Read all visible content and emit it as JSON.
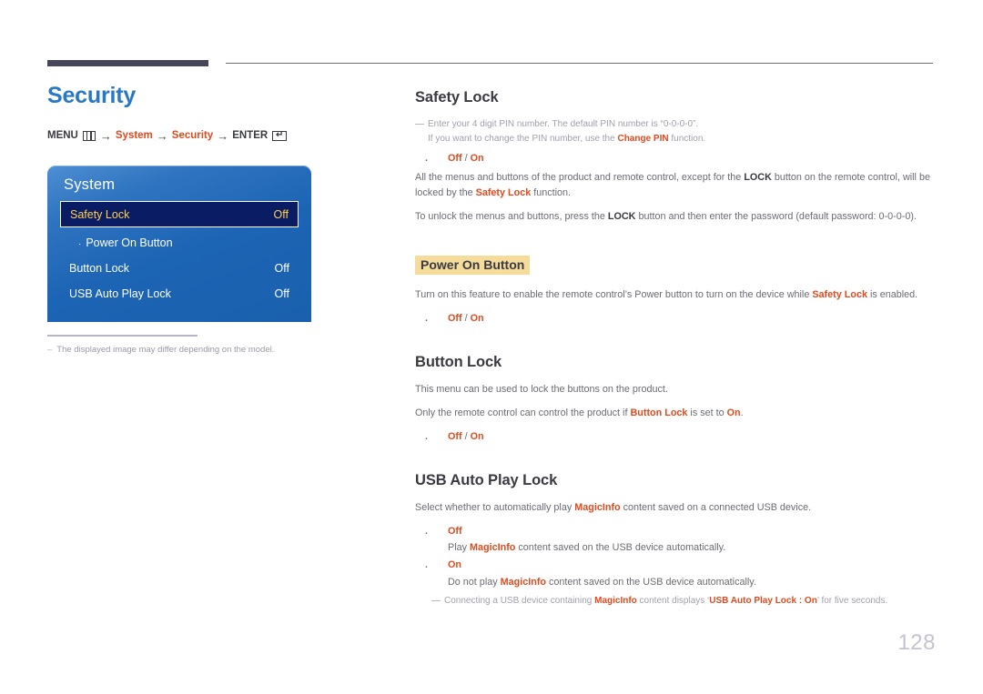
{
  "page": {
    "title": "Security",
    "number": "128"
  },
  "menu_path": {
    "menu_label": "MENU",
    "menu_icon": "menu-grid-icon",
    "arrow": "→",
    "step1": "System",
    "step2": "Security",
    "enter_label": "ENTER",
    "enter_icon": "enter-key-icon"
  },
  "osd": {
    "title": "System",
    "rows": [
      {
        "label": "Safety Lock",
        "value": "Off",
        "selected": true,
        "sub": false
      },
      {
        "label": "Power On Button",
        "value": "",
        "selected": false,
        "sub": true
      },
      {
        "label": "Button Lock",
        "value": "Off",
        "selected": false,
        "sub": false
      },
      {
        "label": "USB Auto Play Lock",
        "value": "Off",
        "selected": false,
        "sub": false
      }
    ]
  },
  "left_note": {
    "dash": "–",
    "text": "The displayed image may differ depending on the model."
  },
  "sections": {
    "safety_lock": {
      "heading": "Safety Lock",
      "note_dash": "—",
      "note_line1": "Enter your 4 digit PIN number. The default PIN number is “0-0-0-0”.",
      "note_line2_pre": "If you want to change the PIN number, use the ",
      "note_line2_accent": "Change PIN",
      "note_line2_post": " function.",
      "option_off": "Off",
      "option_sep": " / ",
      "option_on": "On",
      "para1_a": "All the menus and buttons of the product and remote control, except for the ",
      "para1_lock": "LOCK",
      "para1_b": " button on the remote control, will be locked by the ",
      "para1_accent": "Safety Lock",
      "para1_c": " function.",
      "para2_a": "To unlock the menus and buttons, press the ",
      "para2_lock": "LOCK",
      "para2_b": " button and then enter the password (default password: 0-0-0-0)."
    },
    "power_on_button": {
      "heading": "Power On Button",
      "para_a": "Turn on this feature to enable the remote control’s Power button to turn on the device while ",
      "para_accent": "Safety Lock",
      "para_b": " is enabled.",
      "option_off": "Off",
      "option_sep": " / ",
      "option_on": "On"
    },
    "button_lock": {
      "heading": "Button Lock",
      "para1": "This menu can be used to lock the buttons on the product.",
      "para2_a": "Only the remote control can control the product if ",
      "para2_accent1": "Button Lock",
      "para2_b": " is set to ",
      "para2_accent2": "On",
      "para2_c": ".",
      "option_off": "Off",
      "option_sep": " / ",
      "option_on": "On"
    },
    "usb_auto_play_lock": {
      "heading": "USB Auto Play Lock",
      "intro_a": "Select whether to automatically play ",
      "intro_accent": "MagicInfo",
      "intro_b": " content saved on a connected USB device.",
      "opt1_label": "Off",
      "opt1_desc_a": "Play ",
      "opt1_desc_accent": "MagicInfo",
      "opt1_desc_b": " content saved on the USB device automatically.",
      "opt2_label": "On",
      "opt2_desc_a": "Do not play ",
      "opt2_desc_accent": "MagicInfo",
      "opt2_desc_b": " content saved on the USB device automatically.",
      "note_dash": "—",
      "note_a": "Connecting a USB device containing ",
      "note_accent1": "MagicInfo",
      "note_b": " content displays ‘",
      "note_accent2": "USB Auto Play Lock : On",
      "note_c": "’ for five seconds."
    }
  },
  "colors": {
    "title_blue": "#2878c8",
    "accent_orange": "#e04a1e",
    "highlight_yellow": "#f5dc9a",
    "osd_blue": "#1c64b4",
    "osd_selected_bg": "#0a1c63",
    "osd_selected_text": "#ffd34d",
    "page_number": "#c3c3d2"
  }
}
